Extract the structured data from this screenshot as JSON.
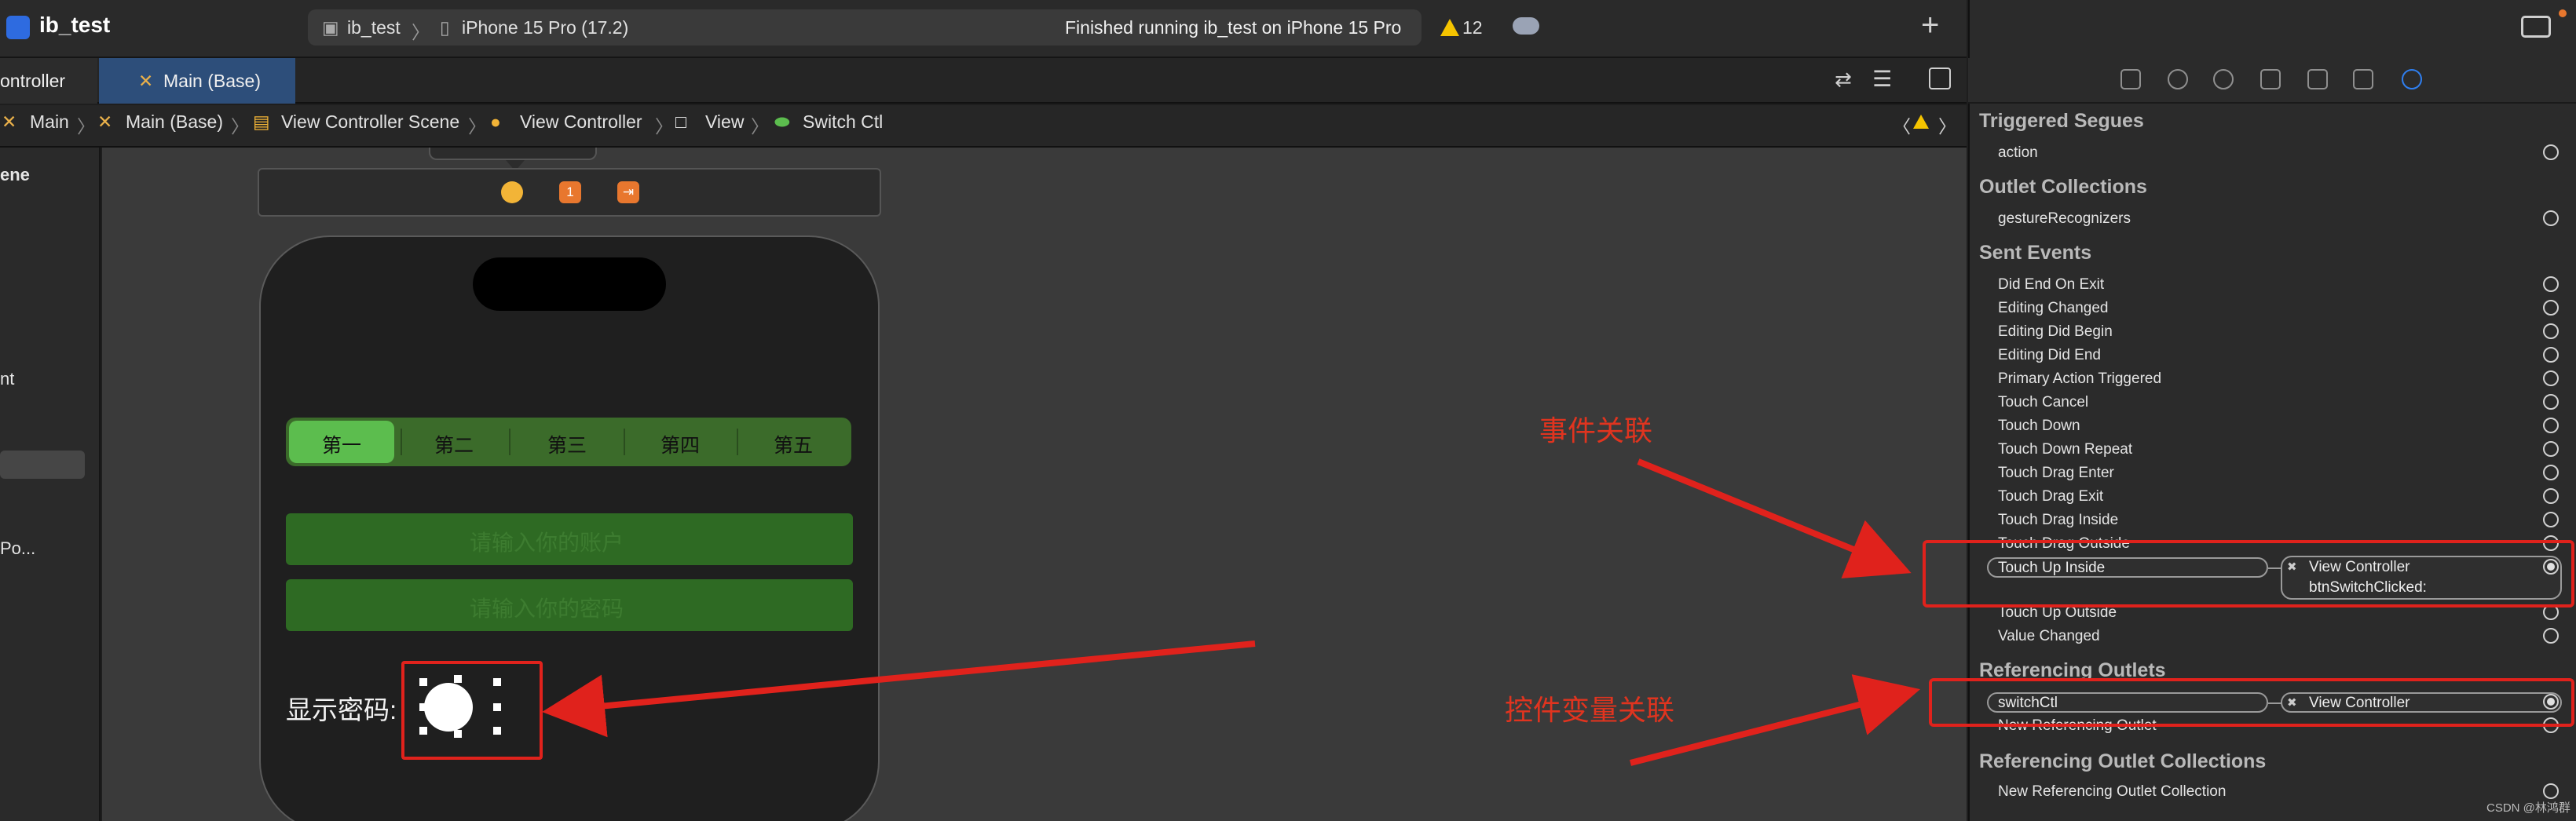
{
  "window": {
    "title": "ib_test",
    "scheme": "ib_test",
    "device": "iPhone 15 Pro (17.2)",
    "status": "Finished running ib_test on iPhone 15 Pro",
    "warning_count": "12",
    "add_label": "+"
  },
  "tabs": {
    "first": "ontroller",
    "active": "Main (Base)"
  },
  "breadcrumb": [
    "Main",
    "Main (Base)",
    "View Controller Scene",
    "View Controller",
    "View",
    "Switch Ctl"
  ],
  "navigator": {
    "items": [
      "ene",
      "nt",
      "Po..."
    ]
  },
  "scene": {
    "dock_badge": "1",
    "segments": [
      "第一",
      "第二",
      "第三",
      "第四",
      "第五"
    ],
    "account_placeholder": "请输入你的账户",
    "password_placeholder": "请输入你的密码",
    "show_password_label": "显示密码:"
  },
  "inspector": {
    "sections": {
      "triggered_segues": "Triggered Segues",
      "outlet_collections": "Outlet Collections",
      "sent_events": "Sent Events",
      "referencing_outlets": "Referencing Outlets",
      "referencing_outlet_collections": "Referencing Outlet Collections"
    },
    "triggered_segues": [
      "action"
    ],
    "outlet_collections": [
      "gestureRecognizers"
    ],
    "sent_events": [
      "Did End On Exit",
      "Editing Changed",
      "Editing Did Begin",
      "Editing Did End",
      "Primary Action Triggered",
      "Touch Cancel",
      "Touch Down",
      "Touch Down Repeat",
      "Touch Drag Enter",
      "Touch Drag Exit",
      "Touch Drag Inside",
      "Touch Drag Outside"
    ],
    "touch_up_inside": {
      "event": "Touch Up Inside",
      "target": "View Controller",
      "action": "btnSwitchClicked:"
    },
    "sent_events_after": [
      "Touch Up Outside",
      "Value Changed"
    ],
    "referencing_outlet": {
      "name": "switchCtl",
      "target": "View Controller"
    },
    "new_referencing_outlet": "New Referencing Outlet",
    "new_referencing_outlet_collection": "New Referencing Outlet Collection"
  },
  "annotations": {
    "event_link": "事件关联",
    "outlet_link": "控件变量关联"
  },
  "watermark": "CSDN @林鸿群",
  "colors": {
    "accent": "#2f7ff0",
    "annotation_red": "#e0221c",
    "segment_green": "#3b6b2a",
    "segment_selected": "#5cbd4e"
  }
}
